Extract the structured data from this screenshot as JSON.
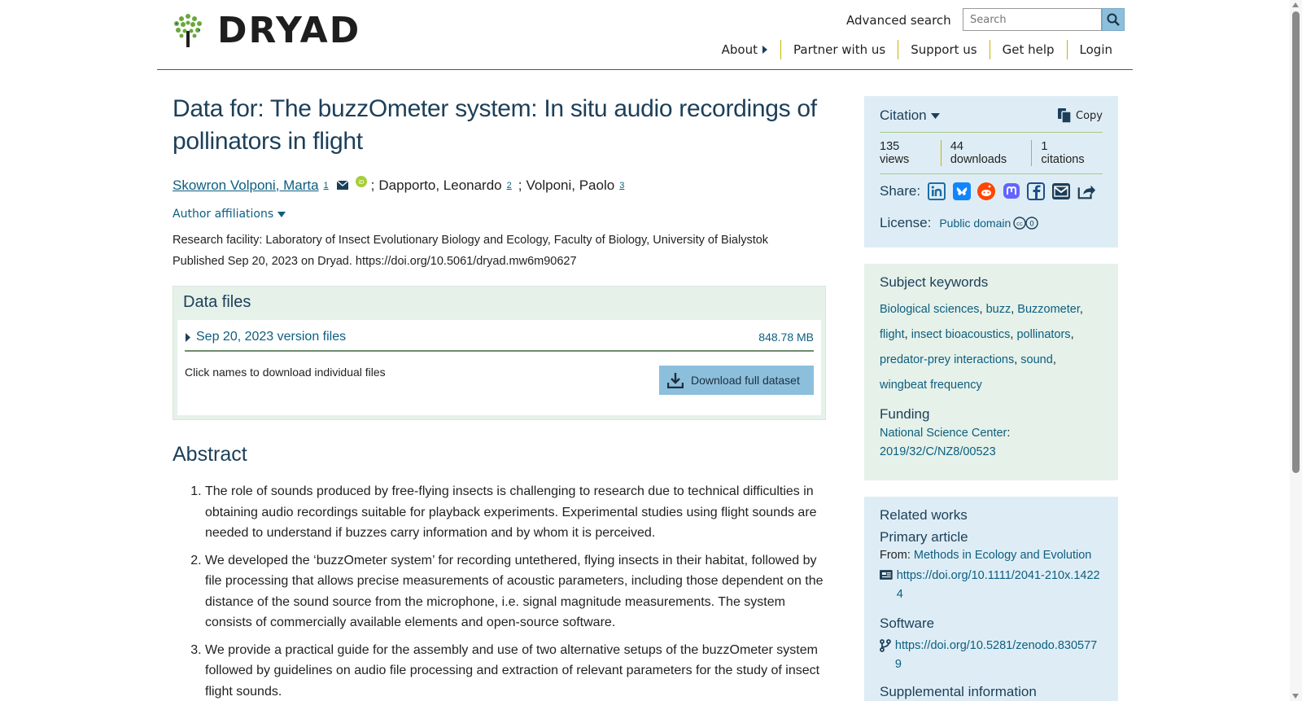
{
  "header": {
    "logo_text": "DRYAD",
    "advanced_search": "Advanced search",
    "search_placeholder": "Search",
    "nav": [
      "About",
      "Partner with us",
      "Support us",
      "Get help",
      "Login"
    ]
  },
  "dataset": {
    "title": "Data for: The buzzOmeter system: In situ audio recordings of pollinators in flight",
    "authors": [
      {
        "name": "Skowron Volponi, Marta",
        "sup": "1"
      },
      {
        "name": "Dapporto, Leonardo",
        "sup": "2"
      },
      {
        "name": "Volponi, Paolo",
        "sup": "3"
      }
    ],
    "author_sep": ";",
    "affiliations_toggle": "Author affiliations",
    "research_facility": "Research facility: Laboratory of Insect Evolutionary Biology and Ecology, Faculty of Biology, University of Bialystok",
    "published": "Published Sep 20, 2023 on Dryad. https://doi.org/10.5061/dryad.mw6m90627"
  },
  "data_files": {
    "heading": "Data files",
    "version_label": "Sep 20, 2023 version files",
    "size": "848.78 MB",
    "note": "Click names to download individual files",
    "download_label": "Download full dataset"
  },
  "abstract": {
    "heading": "Abstract",
    "items": [
      "The role of sounds produced by free-flying insects is challenging to research due to technical difficulties in obtaining audio recordings suitable for playback experiments. Experimental studies using flight sounds are needed to understand if buzzes carry information and by whom it is perceived.",
      "We developed the ‘buzzOmeter system’ for recording untethered, flying insects in their habitat, followed by file processing that allows precise measurements of acoustic parameters, including those dependent on the distance of the sound source from the microphone, i.e. signal magnitude measurements. The system consists of commercially available elements and open-source software.",
      "We provide a practical guide for the assembly and use of two alternative setups of the buzzOmeter system followed by guidelines on audio file processing and extraction of relevant parameters for the study of insect flight sounds."
    ]
  },
  "citation": {
    "label": "Citation",
    "copy_label": "Copy",
    "metrics": [
      "135 views",
      "44 downloads",
      "1 citations"
    ],
    "share_label": "Share:",
    "share_icons": [
      "linkedin-icon",
      "bluesky-icon",
      "reddit-icon",
      "mastodon-icon",
      "facebook-icon",
      "email-icon",
      "share-icon"
    ],
    "license_label": "License:",
    "license_link": "Public domain"
  },
  "keywords": {
    "heading": "Subject keywords",
    "items": [
      "Biological sciences",
      "buzz",
      "Buzzometer",
      "flight",
      "insect bioacoustics",
      "pollinators",
      "predator-prey interactions",
      "sound",
      "wingbeat frequency"
    ],
    "funding_heading": "Funding",
    "funder": "National Science Center",
    "grant": "2019/32/C/NZ8/00523"
  },
  "related": {
    "heading": "Related works",
    "primary_heading": "Primary article",
    "from_label": "From:",
    "journal": "Methods in Ecology and Evolution",
    "primary_doi": "https://doi.org/10.1111/2041-210x.14224",
    "software_heading": "Software",
    "software_doi": "https://doi.org/10.5281/zenodo.8305779",
    "supplemental_heading": "Supplemental information"
  },
  "colors": {
    "accent_link": "#0d5e80",
    "heading": "#1c3f59",
    "citation_bg": "#deedf5",
    "keywords_bg": "#e5f1e9",
    "button_bg": "#8cbfdc",
    "divider_gold": "#c9b400"
  }
}
